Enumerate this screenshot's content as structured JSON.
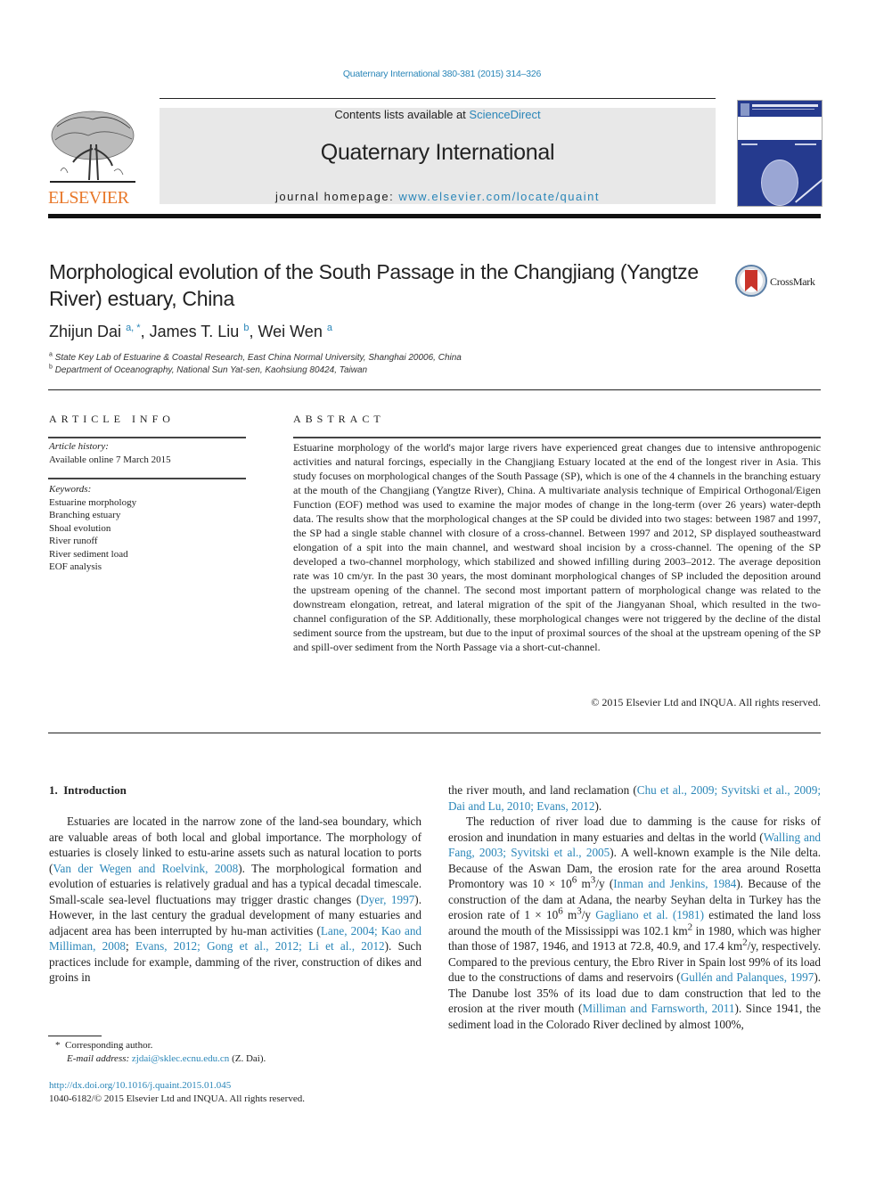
{
  "header": {
    "citation": "Quaternary International 380-381 (2015) 314–326",
    "contents_prefix": "Contents lists available at ",
    "contents_link": "ScienceDirect",
    "journal_title": "Quaternary International",
    "homepage_prefix": "journal homepage: ",
    "homepage_link": "www.elsevier.com/locate/quaint",
    "publisher": "ELSEVIER"
  },
  "crossmark": {
    "label": "CrossMark"
  },
  "article": {
    "title": "Morphological evolution of the South Passage in the Changjiang (Yangtze River) estuary, China",
    "authors": [
      {
        "name": "Zhijun Dai",
        "sup": "a, *"
      },
      {
        "name": "James T. Liu",
        "sup": "b"
      },
      {
        "name": "Wei Wen",
        "sup": "a"
      }
    ],
    "affiliations": [
      {
        "sup": "a",
        "text": "State Key Lab of Estuarine & Coastal Research, East China Normal University, Shanghai 20006, China"
      },
      {
        "sup": "b",
        "text": "Department of Oceanography, National Sun Yat-sen, Kaohsiung 80424, Taiwan"
      }
    ]
  },
  "article_info": {
    "heading": "ARTICLE INFO",
    "history_label": "Article history:",
    "history_value": "Available online 7 March 2015",
    "keywords_label": "Keywords:",
    "keywords": [
      "Estuarine morphology",
      "Branching estuary",
      "Shoal evolution",
      "River runoff",
      "River sediment load",
      "EOF analysis"
    ]
  },
  "abstract": {
    "heading": "ABSTRACT",
    "text": "Estuarine morphology of the world's major large rivers have experienced great changes due to intensive anthropogenic activities and natural forcings, especially in the Changjiang Estuary located at the end of the longest river in Asia. This study focuses on morphological changes of the South Passage (SP), which is one of the 4 channels in the branching estuary at the mouth of the Changjiang (Yangtze River), China. A multivariate analysis technique of Empirical Orthogonal/Eigen Function (EOF) method was used to examine the major modes of change in the long-term (over 26 years) water-depth data. The results show that the morphological changes at the SP could be divided into two stages: between 1987 and 1997, the SP had a single stable channel with closure of a cross-channel. Between 1997 and 2012, SP displayed southeastward elongation of a spit into the main channel, and westward shoal incision by a cross-channel. The opening of the SP developed a two-channel morphology, which stabilized and showed infilling during 2003–2012. The average deposition rate was 10 cm/yr. In the past 30 years, the most dominant morphological changes of SP included the deposition around the upstream opening of the channel. The second most important pattern of morphological change was related to the downstream elongation, retreat, and lateral migration of the spit of the Jiangyanan Shoal, which resulted in the two-channel configuration of the SP. Additionally, these morphological changes were not triggered by the decline of the distal sediment source from the upstream, but due to the input of proximal sources of the shoal at the upstream opening of the SP and spill-over sediment from the North Passage via a short-cut-channel.",
    "copyright": "© 2015 Elsevier Ltd and INQUA. All rights reserved."
  },
  "intro": {
    "heading_num": "1.",
    "heading": "Introduction",
    "left": {
      "t1": "Estuaries are located in the narrow zone of the land-sea boundary, which are valuable areas of both local and global importance. The morphology of estuaries is closely linked to estu-arine assets such as natural location to ports (",
      "l1": "Van der Wegen and Roelvink, 2008",
      "t2": "). The morphological formation and evolution of estuaries is relatively gradual and has a typical decadal timescale. Small-scale sea-level fluctuations may trigger drastic changes (",
      "l2": "Dyer, 1997",
      "t3": "). However, in the last century the gradual development of many estuaries and adjacent area has been interrupted by hu-man activities (",
      "l3": "Lane, 2004; Kao and Milliman, 2008",
      "t4": "; ",
      "l4": "Evans, 2012; Gong et al., 2012; Li et al., 2012",
      "t5": "). Such practices include for example, damming of the river, construction of dikes and groins in"
    },
    "right": {
      "p1_t1": "the river mouth, and land reclamation (",
      "p1_l1": "Chu et al., 2009; Syvitski et al., 2009; Dai and Lu, 2010; Evans, 2012",
      "p1_t2": ").",
      "p2_t1": "The reduction of river load due to damming is the cause for risks of erosion and inundation in many estuaries and deltas in the world (",
      "p2_l1": "Walling and Fang, 2003; Syvitski et al., 2005",
      "p2_t2": "). A well-known example is the Nile delta. Because of the Aswan Dam, the erosion rate for the area around Rosetta Promontory was 10 × 10",
      "p2_s1": "6",
      "p2_t3": " m",
      "p2_s2": "3",
      "p2_t4": "/y (",
      "p2_l2": "Inman and Jenkins, 1984",
      "p2_t5": "). Because of the construction of the dam at Adana, the nearby Seyhan delta in Turkey has the erosion rate of 1 × 10",
      "p2_s3": "6",
      "p2_t6": " m",
      "p2_s4": "3",
      "p2_t7": "/y ",
      "p2_l3": "Gagliano et al. (1981)",
      "p2_t8": " estimated the land loss around the mouth of the Mississippi was 102.1 km",
      "p2_s5": "2",
      "p2_t9": " in 1980, which was higher than those of 1987, 1946, and 1913 at 72.8, 40.9, and 17.4 km",
      "p2_s6": "2",
      "p2_t10": "/y, respectively. Compared to the previous century, the Ebro River in Spain lost 99% of its load due to the constructions of dams and reservoirs (",
      "p2_l4": "Gullén and Palanques, 1997",
      "p2_t11": "). The Danube lost 35% of its load due to dam construction that led to the erosion at the river mouth (",
      "p2_l5": "Milliman and Farnsworth, 2011",
      "p2_t12": "). Since 1941, the sediment load in the Colorado River declined by almost 100%,"
    }
  },
  "footnote": {
    "star": "*",
    "corresponding": "Corresponding author.",
    "email_label": "E-mail address:",
    "email": "zjdai@sklec.ecnu.edu.cn",
    "email_suffix": " (Z. Dai).",
    "doi": "http://dx.doi.org/10.1016/j.quaint.2015.01.045",
    "issn": "1040-6182/© 2015 Elsevier Ltd and INQUA. All rights reserved."
  }
}
